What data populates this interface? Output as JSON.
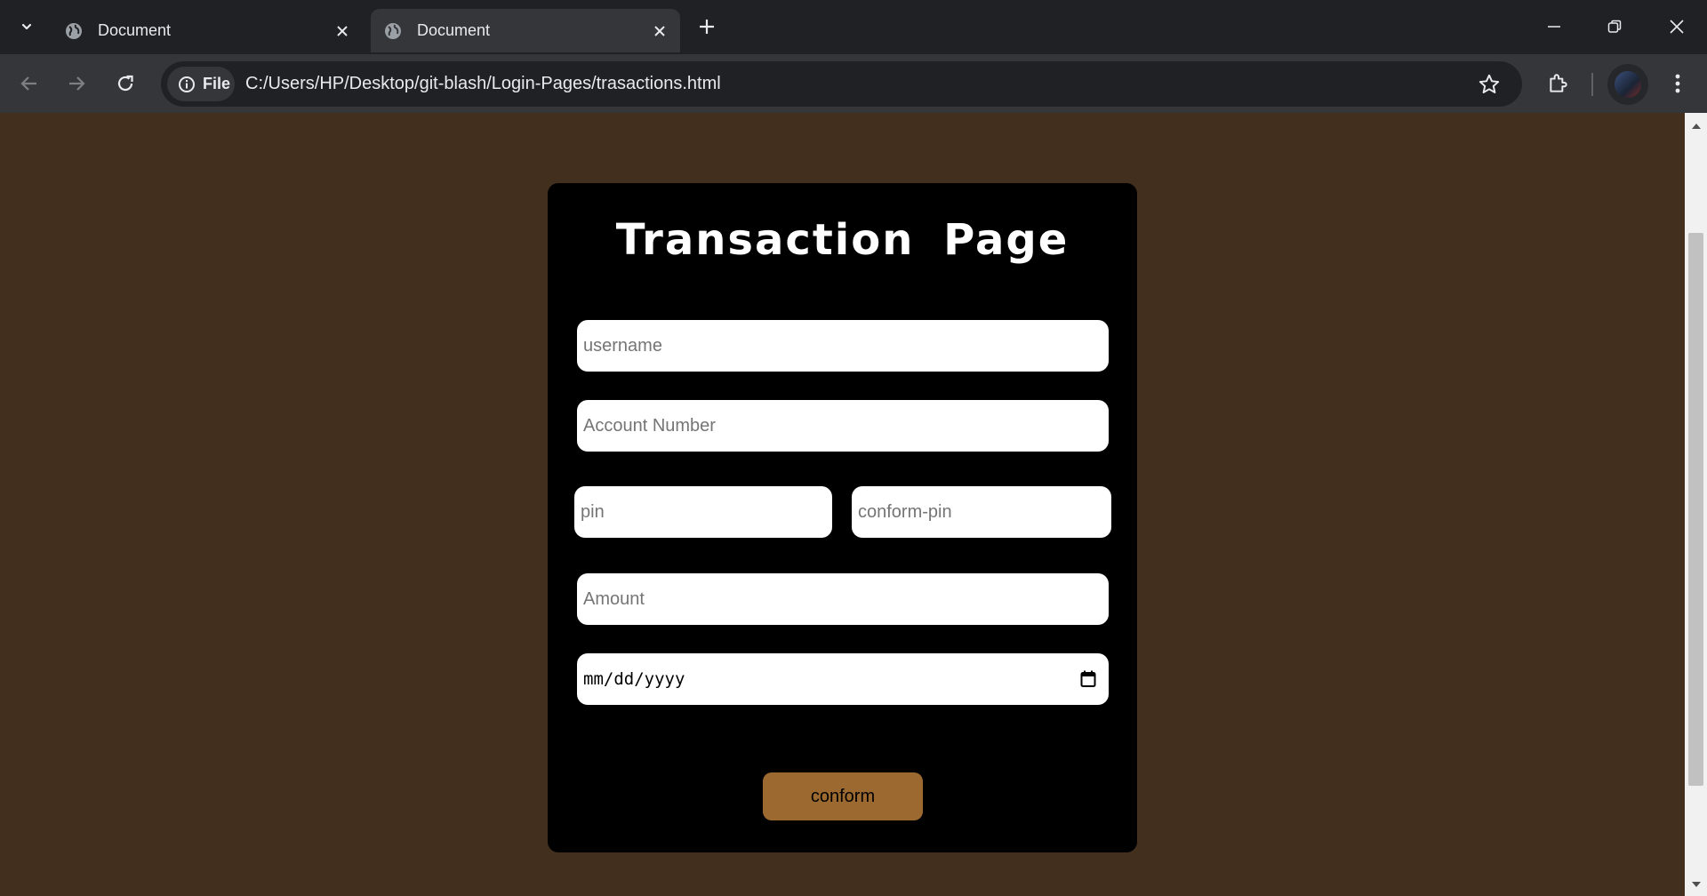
{
  "browser": {
    "tabs": [
      {
        "title": "Document",
        "active": false
      },
      {
        "title": "Document",
        "active": true
      }
    ],
    "address": {
      "scheme_label": "File",
      "url": "C:/Users/HP/Desktop/git-blash/Login-Pages/trasactions.html"
    }
  },
  "page": {
    "title": "Transaction  Page",
    "fields": {
      "username_placeholder": "username",
      "account_placeholder": "Account Number",
      "pin_placeholder": "pin",
      "confirm_pin_placeholder": "conform-pin",
      "amount_placeholder": "Amount",
      "date_placeholder": "mm/dd/yyyy"
    },
    "submit_label": "conform"
  },
  "colors": {
    "page_background": "#432f1e",
    "card_background": "#000000",
    "button_background": "#9c6a30"
  }
}
